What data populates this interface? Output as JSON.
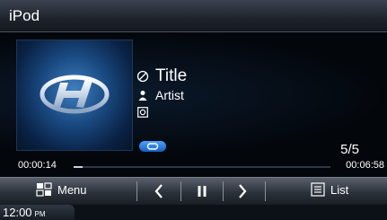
{
  "header": {
    "title": "iPod"
  },
  "now_playing": {
    "title": "Title",
    "artist": "Artist",
    "track_position": "5/5"
  },
  "progress": {
    "elapsed": "00:00:14",
    "total": "00:06:58",
    "fraction": 0.0335
  },
  "controls": {
    "menu_label": "Menu",
    "list_label": "List"
  },
  "status": {
    "time": "12:00",
    "ampm": "PM"
  },
  "icons": {
    "title": "disc-icon",
    "artist": "person-icon",
    "album": "album-icon",
    "repeat": "repeat-icon",
    "menu": "grid-menu-icon",
    "prev": "chevron-left-icon",
    "pause": "pause-icon",
    "next": "chevron-right-icon",
    "list": "list-icon"
  },
  "colors": {
    "accent": "#2f7fe0",
    "background": "#03070c"
  }
}
